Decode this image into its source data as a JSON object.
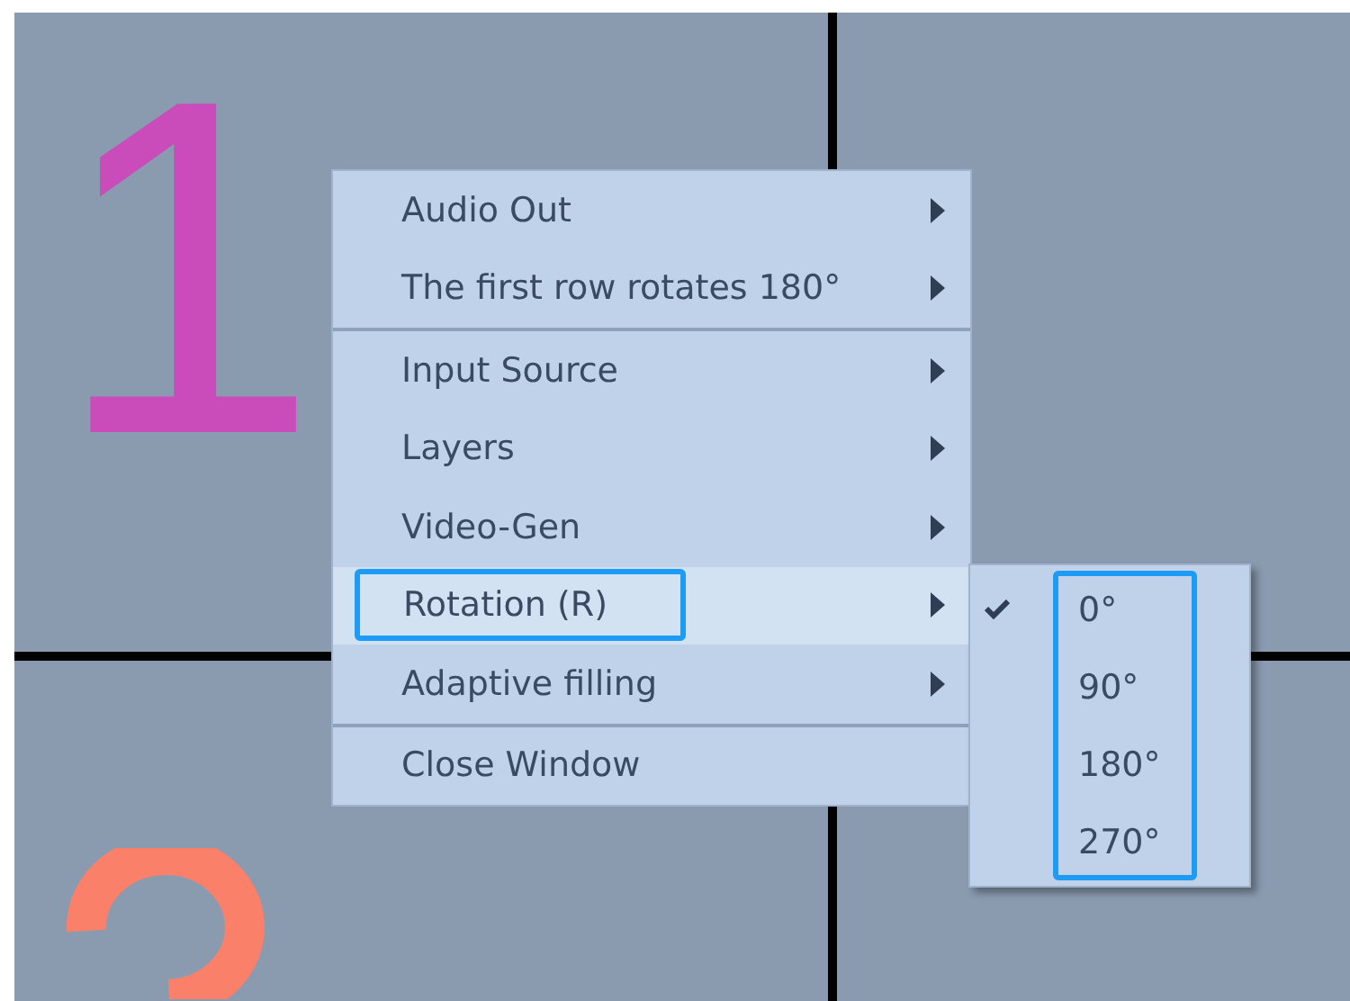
{
  "canvas": {
    "panel_label": "1"
  },
  "context_menu": {
    "groups": [
      [
        {
          "label": "Audio Out",
          "has_submenu": true,
          "selected": false
        },
        {
          "label": "The first row rotates 180°",
          "has_submenu": true,
          "selected": false
        }
      ],
      [
        {
          "label": "Input Source",
          "has_submenu": true,
          "selected": false
        },
        {
          "label": "Layers",
          "has_submenu": true,
          "selected": false
        },
        {
          "label": "Video-Gen",
          "has_submenu": true,
          "selected": false
        },
        {
          "label": "Rotation (R)",
          "has_submenu": true,
          "selected": true
        },
        {
          "label": "Adaptive filling",
          "has_submenu": true,
          "selected": false
        }
      ],
      [
        {
          "label": "Close Window",
          "has_submenu": false,
          "selected": false
        }
      ]
    ]
  },
  "submenu": {
    "items": [
      {
        "label": "0°",
        "checked": true
      },
      {
        "label": "90°",
        "checked": false
      },
      {
        "label": "180°",
        "checked": false
      },
      {
        "label": "270°",
        "checked": false
      }
    ]
  }
}
